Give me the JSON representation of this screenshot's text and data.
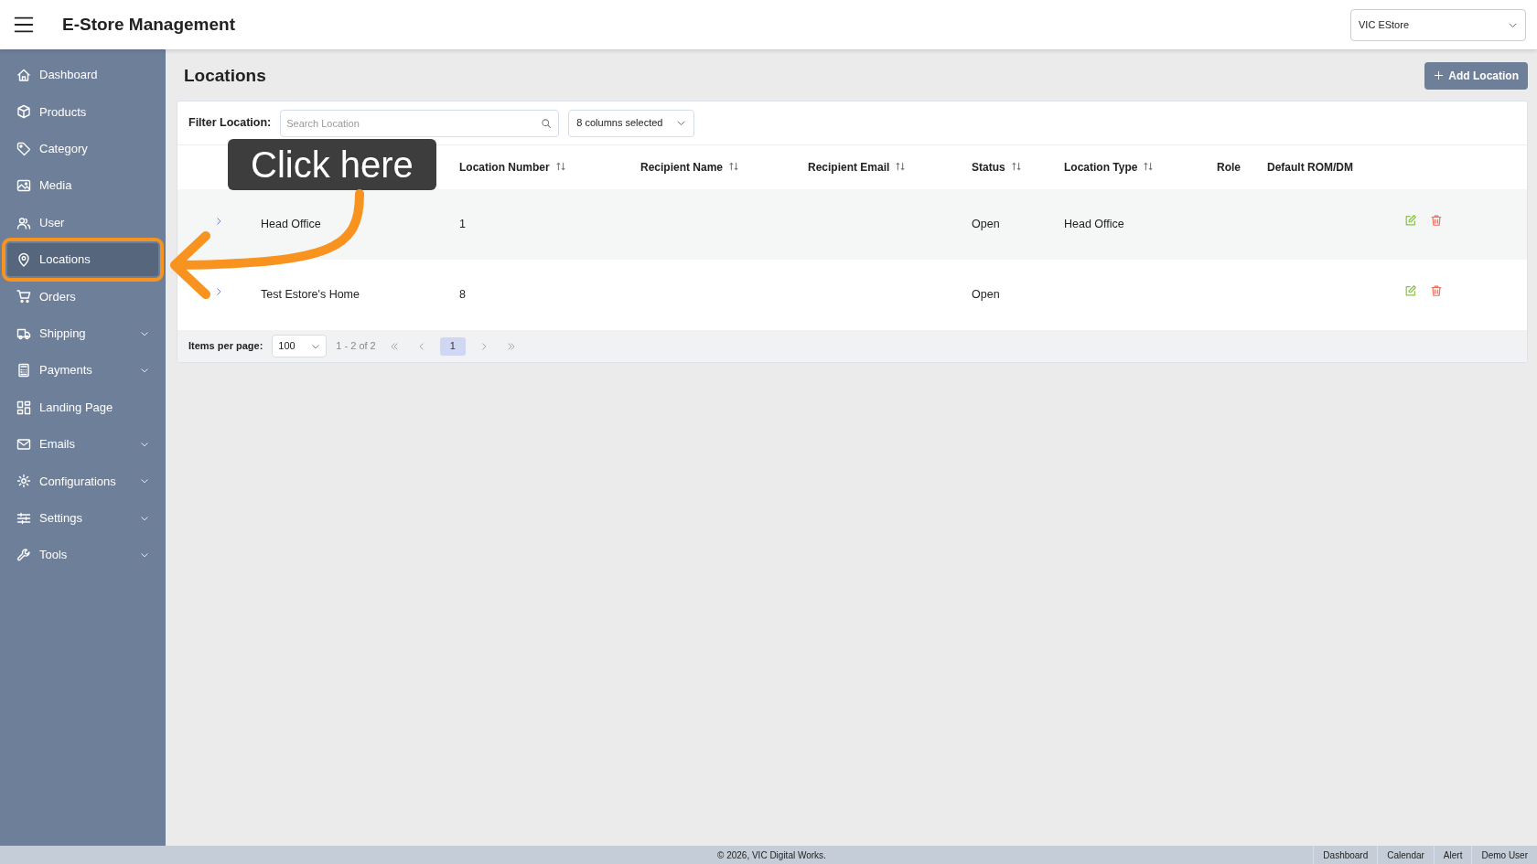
{
  "app": {
    "title": "E-Store Management",
    "store_select": "VIC EStore"
  },
  "sidebar": {
    "items": [
      {
        "label": "Dashboard",
        "selected": false,
        "highlighted": false,
        "has_submenu": false
      },
      {
        "label": "Products",
        "selected": false,
        "highlighted": false,
        "has_submenu": false
      },
      {
        "label": "Category",
        "selected": false,
        "highlighted": false,
        "has_submenu": false
      },
      {
        "label": "Media",
        "selected": false,
        "highlighted": false,
        "has_submenu": false
      },
      {
        "label": "User",
        "selected": false,
        "highlighted": false,
        "has_submenu": false
      },
      {
        "label": "Locations",
        "selected": true,
        "highlighted": true,
        "has_submenu": false
      },
      {
        "label": "Orders",
        "selected": false,
        "highlighted": false,
        "has_submenu": false
      },
      {
        "label": "Shipping",
        "selected": false,
        "highlighted": false,
        "has_submenu": true
      },
      {
        "label": "Payments",
        "selected": false,
        "highlighted": false,
        "has_submenu": true
      },
      {
        "label": "Landing Page",
        "selected": false,
        "highlighted": false,
        "has_submenu": false
      },
      {
        "label": "Emails",
        "selected": false,
        "highlighted": false,
        "has_submenu": true
      },
      {
        "label": "Configurations",
        "selected": false,
        "highlighted": false,
        "has_submenu": true
      },
      {
        "label": "Settings",
        "selected": false,
        "highlighted": false,
        "has_submenu": true
      },
      {
        "label": "Tools",
        "selected": false,
        "highlighted": false,
        "has_submenu": true
      }
    ]
  },
  "page": {
    "title": "Locations",
    "add_button": "Add Location"
  },
  "filter": {
    "label": "Filter Location:",
    "placeholder": "Search Location",
    "columns_select": "8 columns selected"
  },
  "table": {
    "columns": [
      {
        "label": "Location Number",
        "sortable": true
      },
      {
        "label": "Recipient Name",
        "sortable": true
      },
      {
        "label": "Recipient Email",
        "sortable": true
      },
      {
        "label": "Status",
        "sortable": true
      },
      {
        "label": "Location Type",
        "sortable": true
      },
      {
        "label": "Role",
        "sortable": false
      },
      {
        "label": "Default ROM/DM",
        "sortable": false
      }
    ],
    "rows": [
      {
        "location_name": "Head Office",
        "cells": [
          "1",
          "",
          "",
          "Open",
          "Head Office",
          "",
          ""
        ]
      },
      {
        "location_name": "Test Estore's Home",
        "cells": [
          "8",
          "",
          "",
          "Open",
          "",
          "",
          ""
        ]
      }
    ]
  },
  "pagination": {
    "label": "Items per page:",
    "page_size": "100",
    "range": "1 - 2 of 2",
    "pages": [
      {
        "label": "1",
        "selected": true
      }
    ]
  },
  "footer": {
    "copyright": "© 2026, VIC Digital Works.",
    "links": [
      "Dashboard",
      "Calendar",
      "Alert",
      "Demo User"
    ]
  },
  "annotation": {
    "callout": "Click here"
  }
}
